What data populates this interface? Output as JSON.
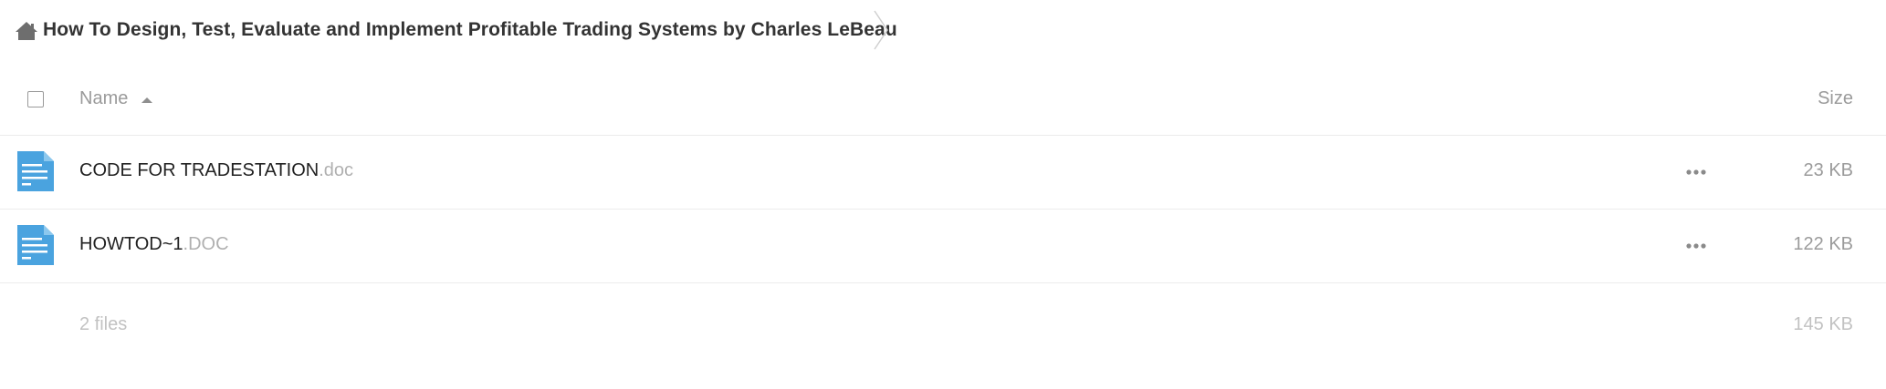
{
  "breadcrumb": {
    "home_icon": "home-icon",
    "folder_name": "How To Design, Test, Evaluate and Implement Profitable Trading Systems by Charles LeBeau"
  },
  "table": {
    "header": {
      "name_label": "Name",
      "size_label": "Size",
      "sort_direction": "ascending"
    },
    "files": [
      {
        "base": "CODE FOR TRADESTATION",
        "ext": ".doc",
        "size": "23 KB",
        "icon": "document-icon"
      },
      {
        "base": "HOWTOD~1",
        "ext": ".DOC",
        "size": "122 KB",
        "icon": "document-icon"
      }
    ],
    "summary": {
      "count": "2 files",
      "total_size": "145 KB"
    }
  },
  "colors": {
    "file_icon": "#4aa3df",
    "accent_text": "#333333"
  }
}
